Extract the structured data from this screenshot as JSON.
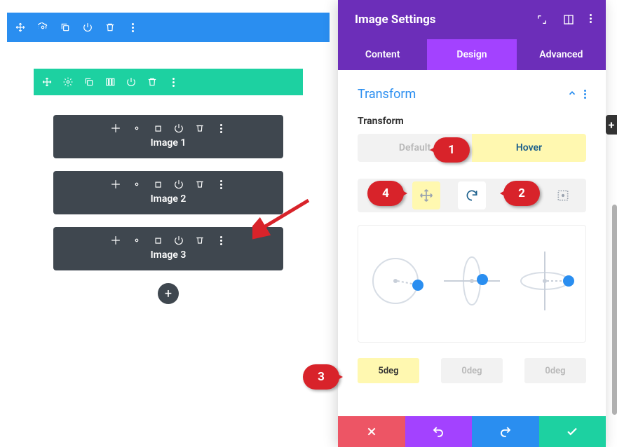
{
  "builder": {
    "modules": [
      {
        "label": "Image 1"
      },
      {
        "label": "Image 2"
      },
      {
        "label": "Image 3"
      }
    ]
  },
  "panel": {
    "title": "Image Settings",
    "tabs": {
      "content": "Content",
      "design": "Design",
      "advanced": "Advanced"
    },
    "section_title": "Transform",
    "subhead": "Transform",
    "state": {
      "default": "Default",
      "hover": "Hover"
    },
    "values": {
      "rot_z": "5deg",
      "rot_x": "0deg",
      "rot_y": "0deg"
    }
  },
  "markers": {
    "m1": "1",
    "m2": "2",
    "m3": "3",
    "m4": "4"
  }
}
